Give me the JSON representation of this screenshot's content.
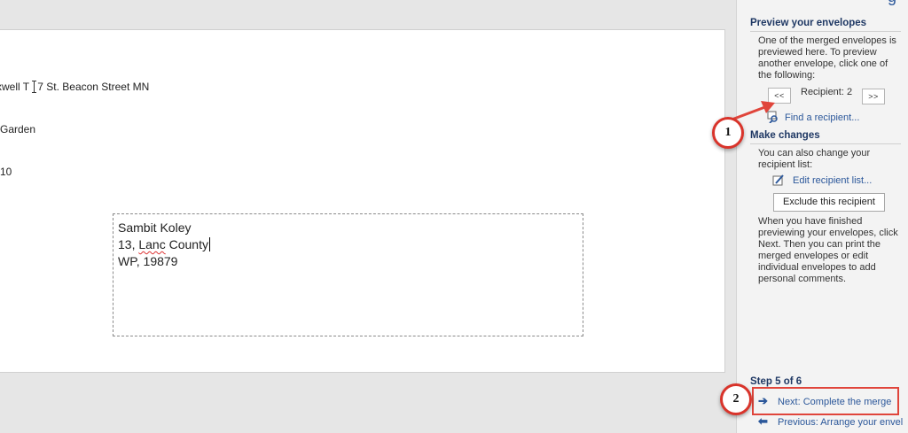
{
  "document": {
    "return_address": [
      "xwell T ",
      "7 St. Beacon Street MN",
      "Garden",
      "10"
    ],
    "recipient_address": {
      "name": "Sambit Koley",
      "line2_prefix": "13, ",
      "line2_misspelled": "Lanc",
      "line2_suffix": " County",
      "line3": "WP, 19879"
    }
  },
  "pane": {
    "title_fragment": "g",
    "preview": {
      "heading": "Preview your envelopes",
      "description": "One of the merged envelopes is previewed here. To preview another envelope, click one of the following:",
      "prev_button": "<<",
      "recipient_label": "Recipient: 2",
      "next_button": ">>",
      "find_link": "Find a recipient..."
    },
    "changes": {
      "heading": "Make changes",
      "description": "You can also change your recipient list:",
      "edit_link": "Edit recipient list...",
      "exclude_button": "Exclude this recipient",
      "finish_text": "When you have finished previewing your envelopes, click Next. Then you can print the merged envelopes or edit individual envelopes to add personal comments."
    },
    "step": {
      "label": "Step 5 of 6",
      "next_link": "Next: Complete the merge",
      "prev_link": "Previous: Arrange your envel"
    }
  },
  "annotations": {
    "callout_1": "1",
    "callout_2": "2",
    "color": "#d9342b"
  }
}
